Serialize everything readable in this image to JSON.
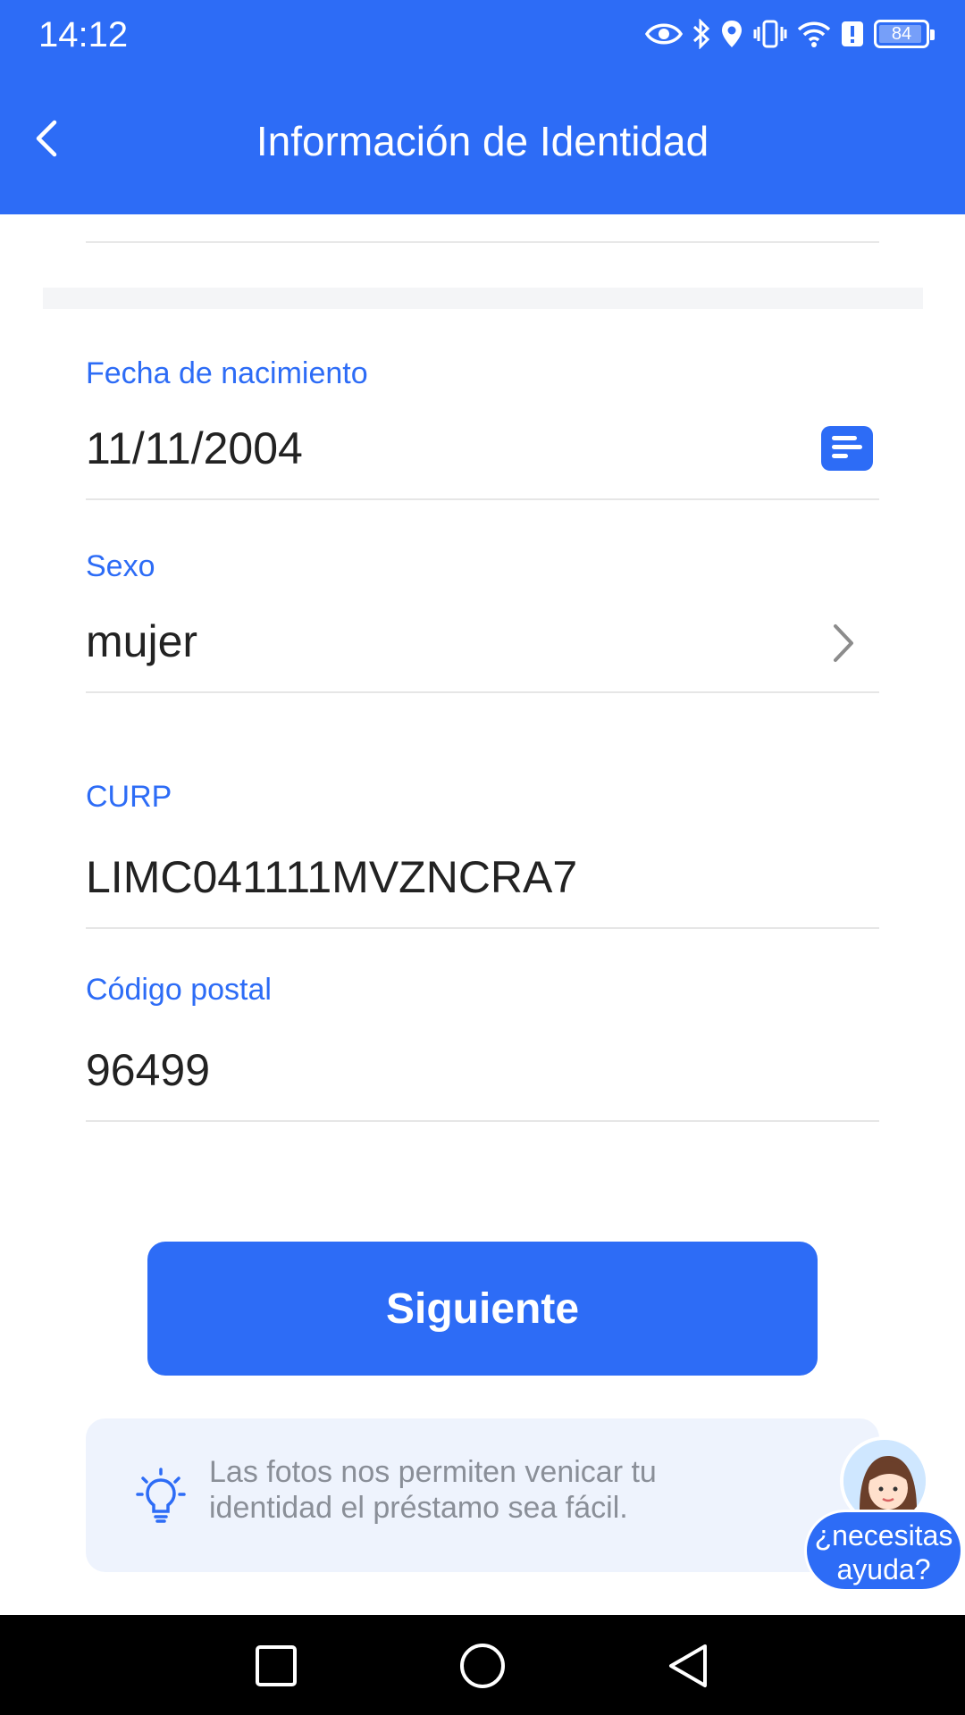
{
  "status_bar": {
    "time": "14:12",
    "battery_level": "84",
    "icons": [
      "eye-icon",
      "bluetooth-icon",
      "location-icon",
      "vibrate-icon",
      "wifi-icon",
      "alert-icon",
      "battery-icon"
    ]
  },
  "header": {
    "title": "Información de Identidad",
    "background_color": "#2d6cf6"
  },
  "form": {
    "birth_date": {
      "label": "Fecha de nacimiento",
      "value": "11/11/2004",
      "icon": "calendar-icon"
    },
    "sex": {
      "label": "Sexo",
      "value": "mujer",
      "icon": "chevron-right-icon"
    },
    "curp": {
      "label": "CURP",
      "value": "LIMC041111MVZNCRA7"
    },
    "postal_code": {
      "label": "Código postal",
      "value": "96499"
    }
  },
  "next_button": {
    "label": "Siguiente"
  },
  "tip": {
    "icon": "lightbulb-icon",
    "text": "Las fotos nos permiten venicar tu identidad el préstamo sea fácil."
  },
  "help": {
    "label": "¿necesitas ayuda?"
  },
  "nav_bar": {
    "buttons": [
      "recents-square-icon",
      "home-circle-icon",
      "back-triangle-icon"
    ]
  },
  "colors": {
    "accent": "#2d6cf6",
    "label": "#2d6cf6",
    "value_text": "#222222",
    "tip_background": "#eef3fd",
    "tip_text": "#8a8f98"
  }
}
